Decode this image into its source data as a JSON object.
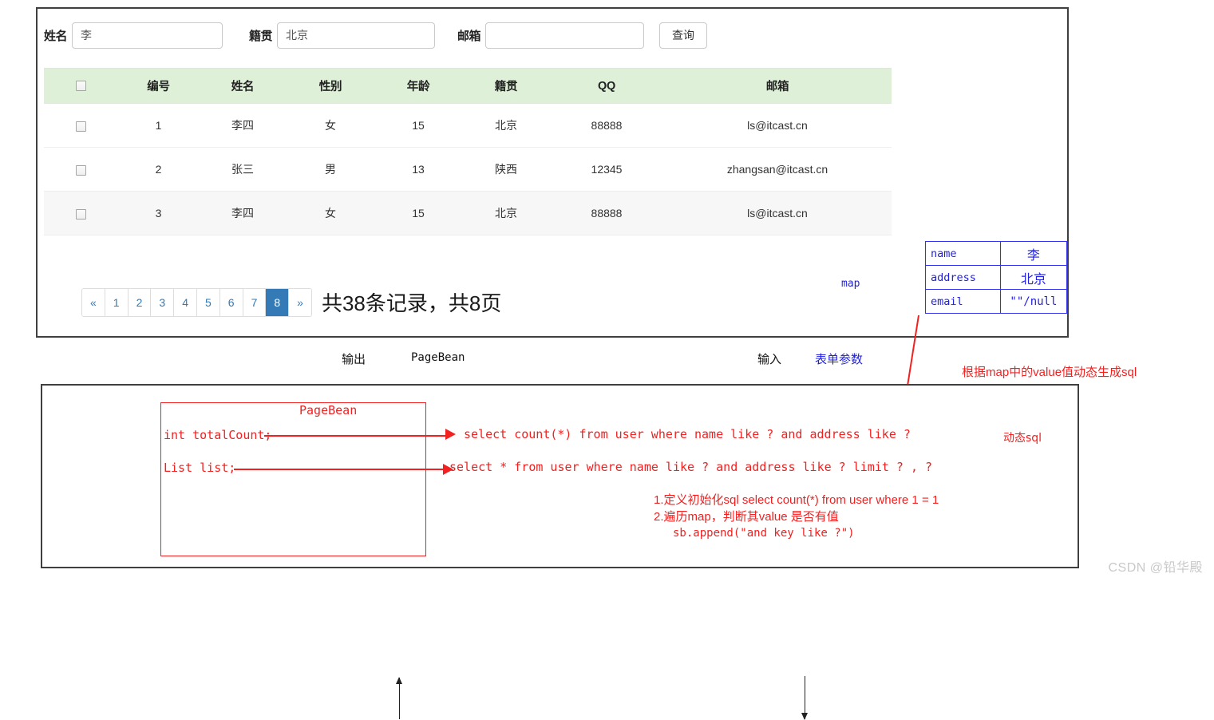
{
  "search_form": {
    "name_label": "姓名",
    "name_value": "李",
    "name_placeholder": "",
    "origin_label": "籍贯",
    "origin_value": "北京",
    "origin_placeholder": "",
    "email_label": "邮箱",
    "email_value": "",
    "email_placeholder": "",
    "query_button": "查询"
  },
  "table": {
    "headers": [
      "",
      "编号",
      "姓名",
      "性别",
      "年龄",
      "籍贯",
      "QQ",
      "邮箱"
    ],
    "rows": [
      {
        "id": "1",
        "name": "李四",
        "sex": "女",
        "age": "15",
        "origin": "北京",
        "qq": "88888",
        "email": "ls@itcast.cn"
      },
      {
        "id": "2",
        "name": "张三",
        "sex": "男",
        "age": "13",
        "origin": "陕西",
        "qq": "12345",
        "email": "zhangsan@itcast.cn"
      },
      {
        "id": "3",
        "name": "李四",
        "sex": "女",
        "age": "15",
        "origin": "北京",
        "qq": "88888",
        "email": "ls@itcast.cn"
      }
    ]
  },
  "pagination": {
    "prev": "«",
    "pages": [
      "1",
      "2",
      "3",
      "4",
      "5",
      "6",
      "7",
      "8"
    ],
    "active_page": "8",
    "next": "»",
    "summary": "共38条记录，共8页"
  },
  "map_box": {
    "label": "map",
    "rows": [
      {
        "key": "name",
        "value": "李"
      },
      {
        "key": "address",
        "value": "北京"
      },
      {
        "key": "email",
        "value": "\"\"/null"
      }
    ]
  },
  "annotations": {
    "output_label": "输出",
    "output_value": "PageBean",
    "input_label": "输入",
    "input_value": "表单参数",
    "dynamic_sql_from_map": "根据map中的value值动态生成sql"
  },
  "bottom_panel": {
    "field_totalcount": "int totalCount;",
    "field_list": "List list;",
    "pagebean_label": "PageBean",
    "sql_count": "select count(*) from user where name like ? and address like ?",
    "sql_select": "select * from user where name like ? and address like ? limit ? , ?",
    "dynamic_sql_label": "动态sql",
    "step1": "1.定义初始化sql select count(*) from user where 1 = 1",
    "step2": "2.遍历map，判断其value 是否有值",
    "step2_sub": "sb.append(\"and  key like ?\")"
  },
  "watermark": "CSDN @铅华殿",
  "colors": {
    "header_green": "#dff0d8",
    "pager_active": "#337ab7",
    "pager_link": "#337ab7",
    "annotation_red": "#f32020",
    "annotation_blue": "#2222dd"
  }
}
